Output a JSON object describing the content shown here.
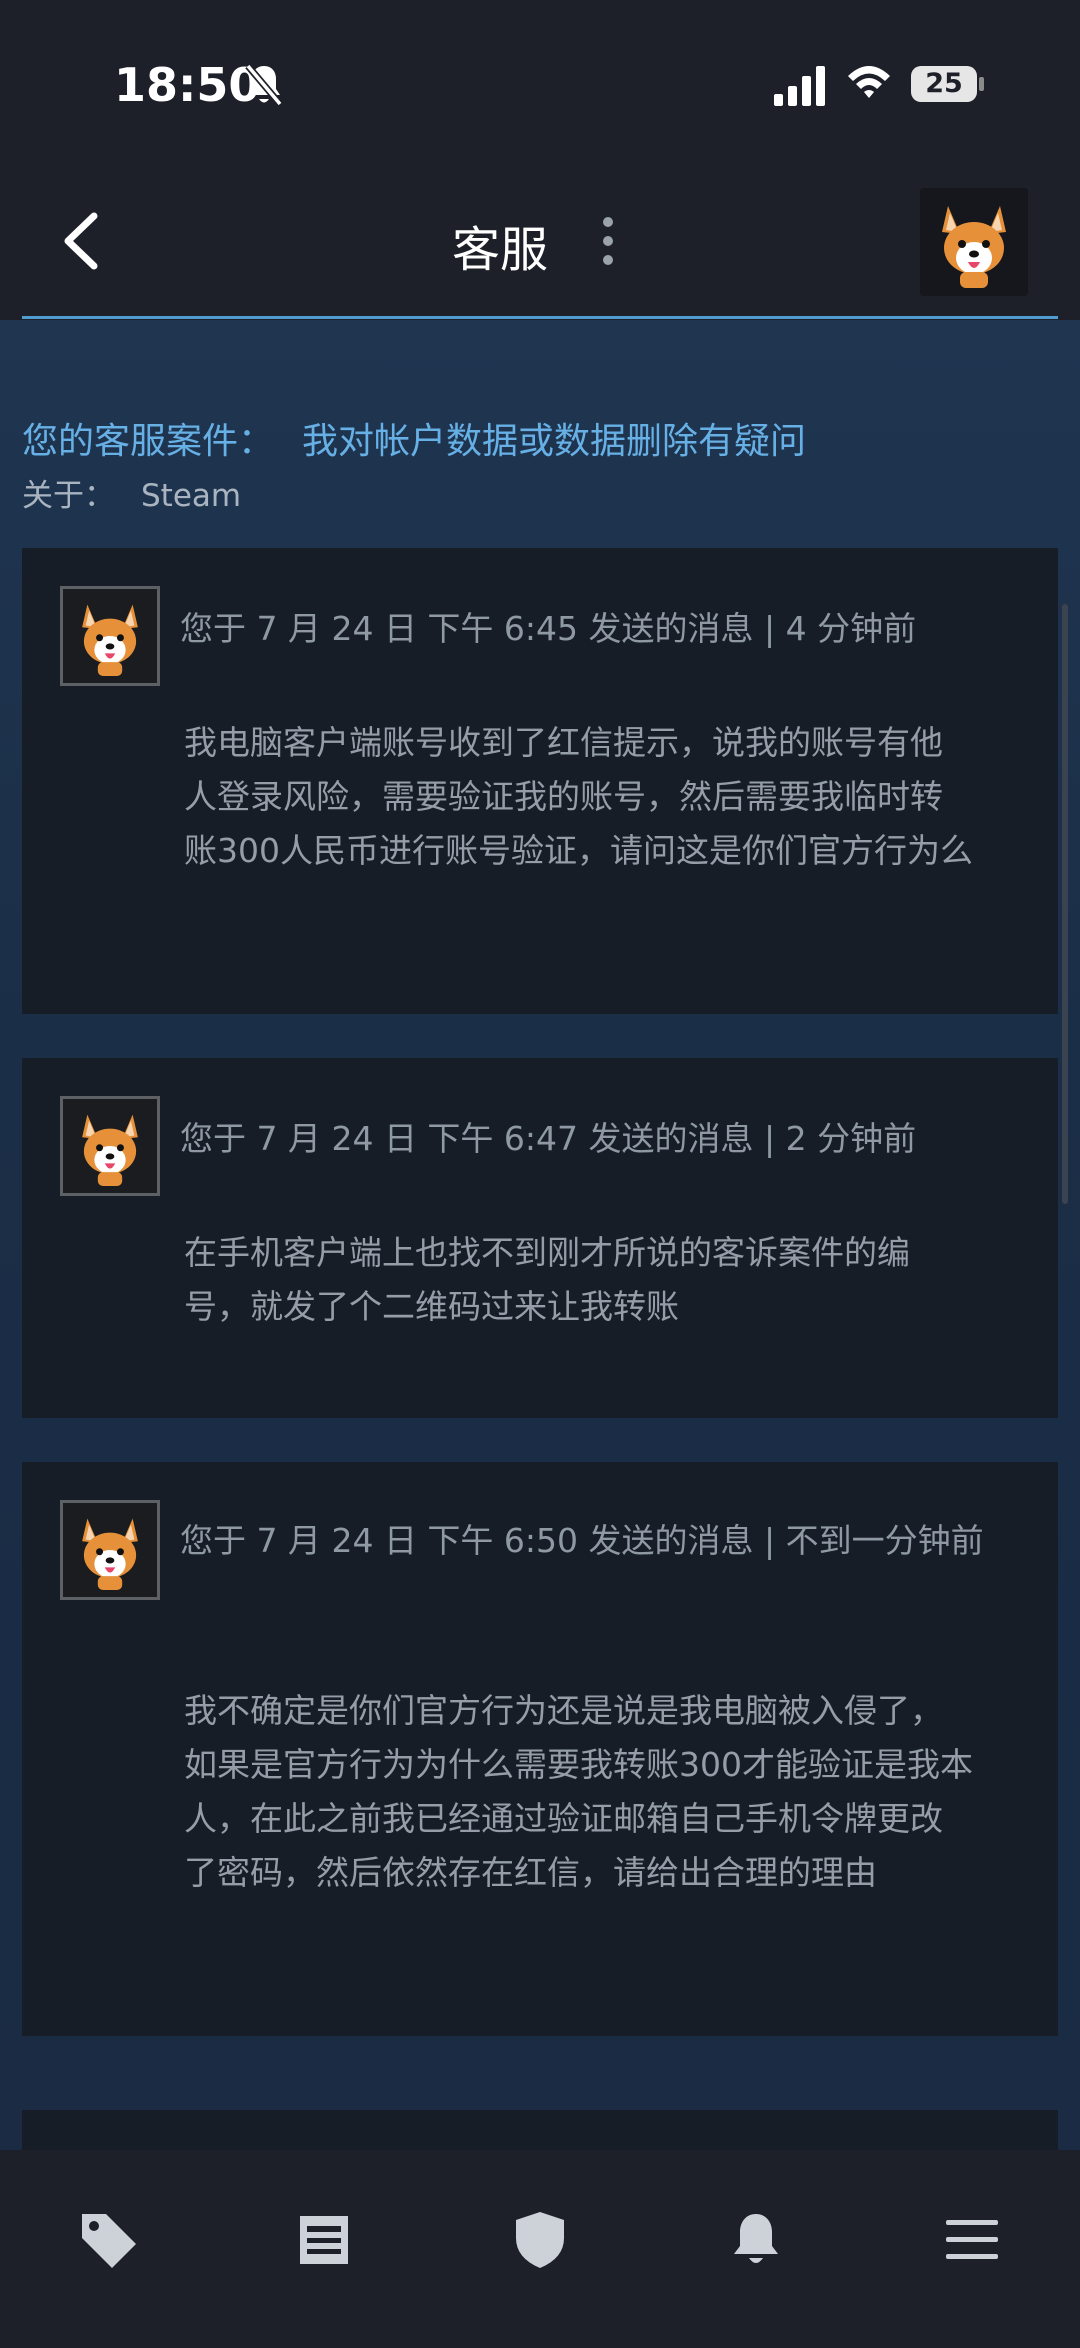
{
  "status_bar": {
    "time": "18:50",
    "battery": "25"
  },
  "header": {
    "title": "客服"
  },
  "case": {
    "label": "您的客服案件：",
    "subject": "我对帐户数据或数据删除有疑问",
    "about_label": "关于：",
    "about_value": "Steam"
  },
  "messages": [
    {
      "meta": "您于 7 月 24 日 下午 6:45 发送的消息 | 4 分钟前",
      "body": "我电脑客户端账号收到了红信提示，说我的账号有他人登录风险，需要验证我的账号，然后需要我临时转账300人民币进行账号验证，请问这是你们官方行为么"
    },
    {
      "meta": "您于 7 月 24 日 下午 6:47 发送的消息 | 2 分钟前",
      "body": "在手机客户端上也找不到刚才所说的客诉案件的编号，就发了个二维码过来让我转账"
    },
    {
      "meta": "您于 7 月 24 日 下午 6:50 发送的消息 | 不到一分钟前",
      "body": "我不确定是你们官方行为还是说是我电脑被入侵了，如果是官方行为为什么需要我转账300才能验证是我本人，在此之前我已经通过验证邮箱自己手机令牌更改了密码，然后依然存在红信，请给出合理的理由"
    }
  ],
  "bottom_nav": [
    "tag-icon",
    "news-icon",
    "shield-icon",
    "bell-icon",
    "menu-icon"
  ],
  "colors": {
    "accent": "#67b0e6",
    "header_line": "#4f9dd0",
    "background": "#1d2029",
    "card": "#161d27"
  }
}
